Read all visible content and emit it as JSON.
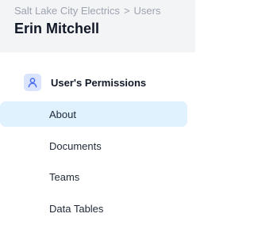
{
  "header": {
    "breadcrumb": {
      "parent": "Salt Lake City Electrics",
      "separator": ">",
      "current": "Users"
    },
    "title": "Erin Mitchell"
  },
  "sidebar": {
    "section": {
      "label": "User's Permissions",
      "icon": "user-icon"
    },
    "items": [
      {
        "label": "About",
        "active": true
      },
      {
        "label": "Documents",
        "active": false
      },
      {
        "label": "Teams",
        "active": false
      },
      {
        "label": "Data Tables",
        "active": false
      }
    ]
  },
  "colors": {
    "header_bg": "#f3f4f6",
    "active_bg": "#e0f2fe",
    "icon_bg": "#dbe4ff",
    "icon_stroke": "#4c6ef5"
  }
}
